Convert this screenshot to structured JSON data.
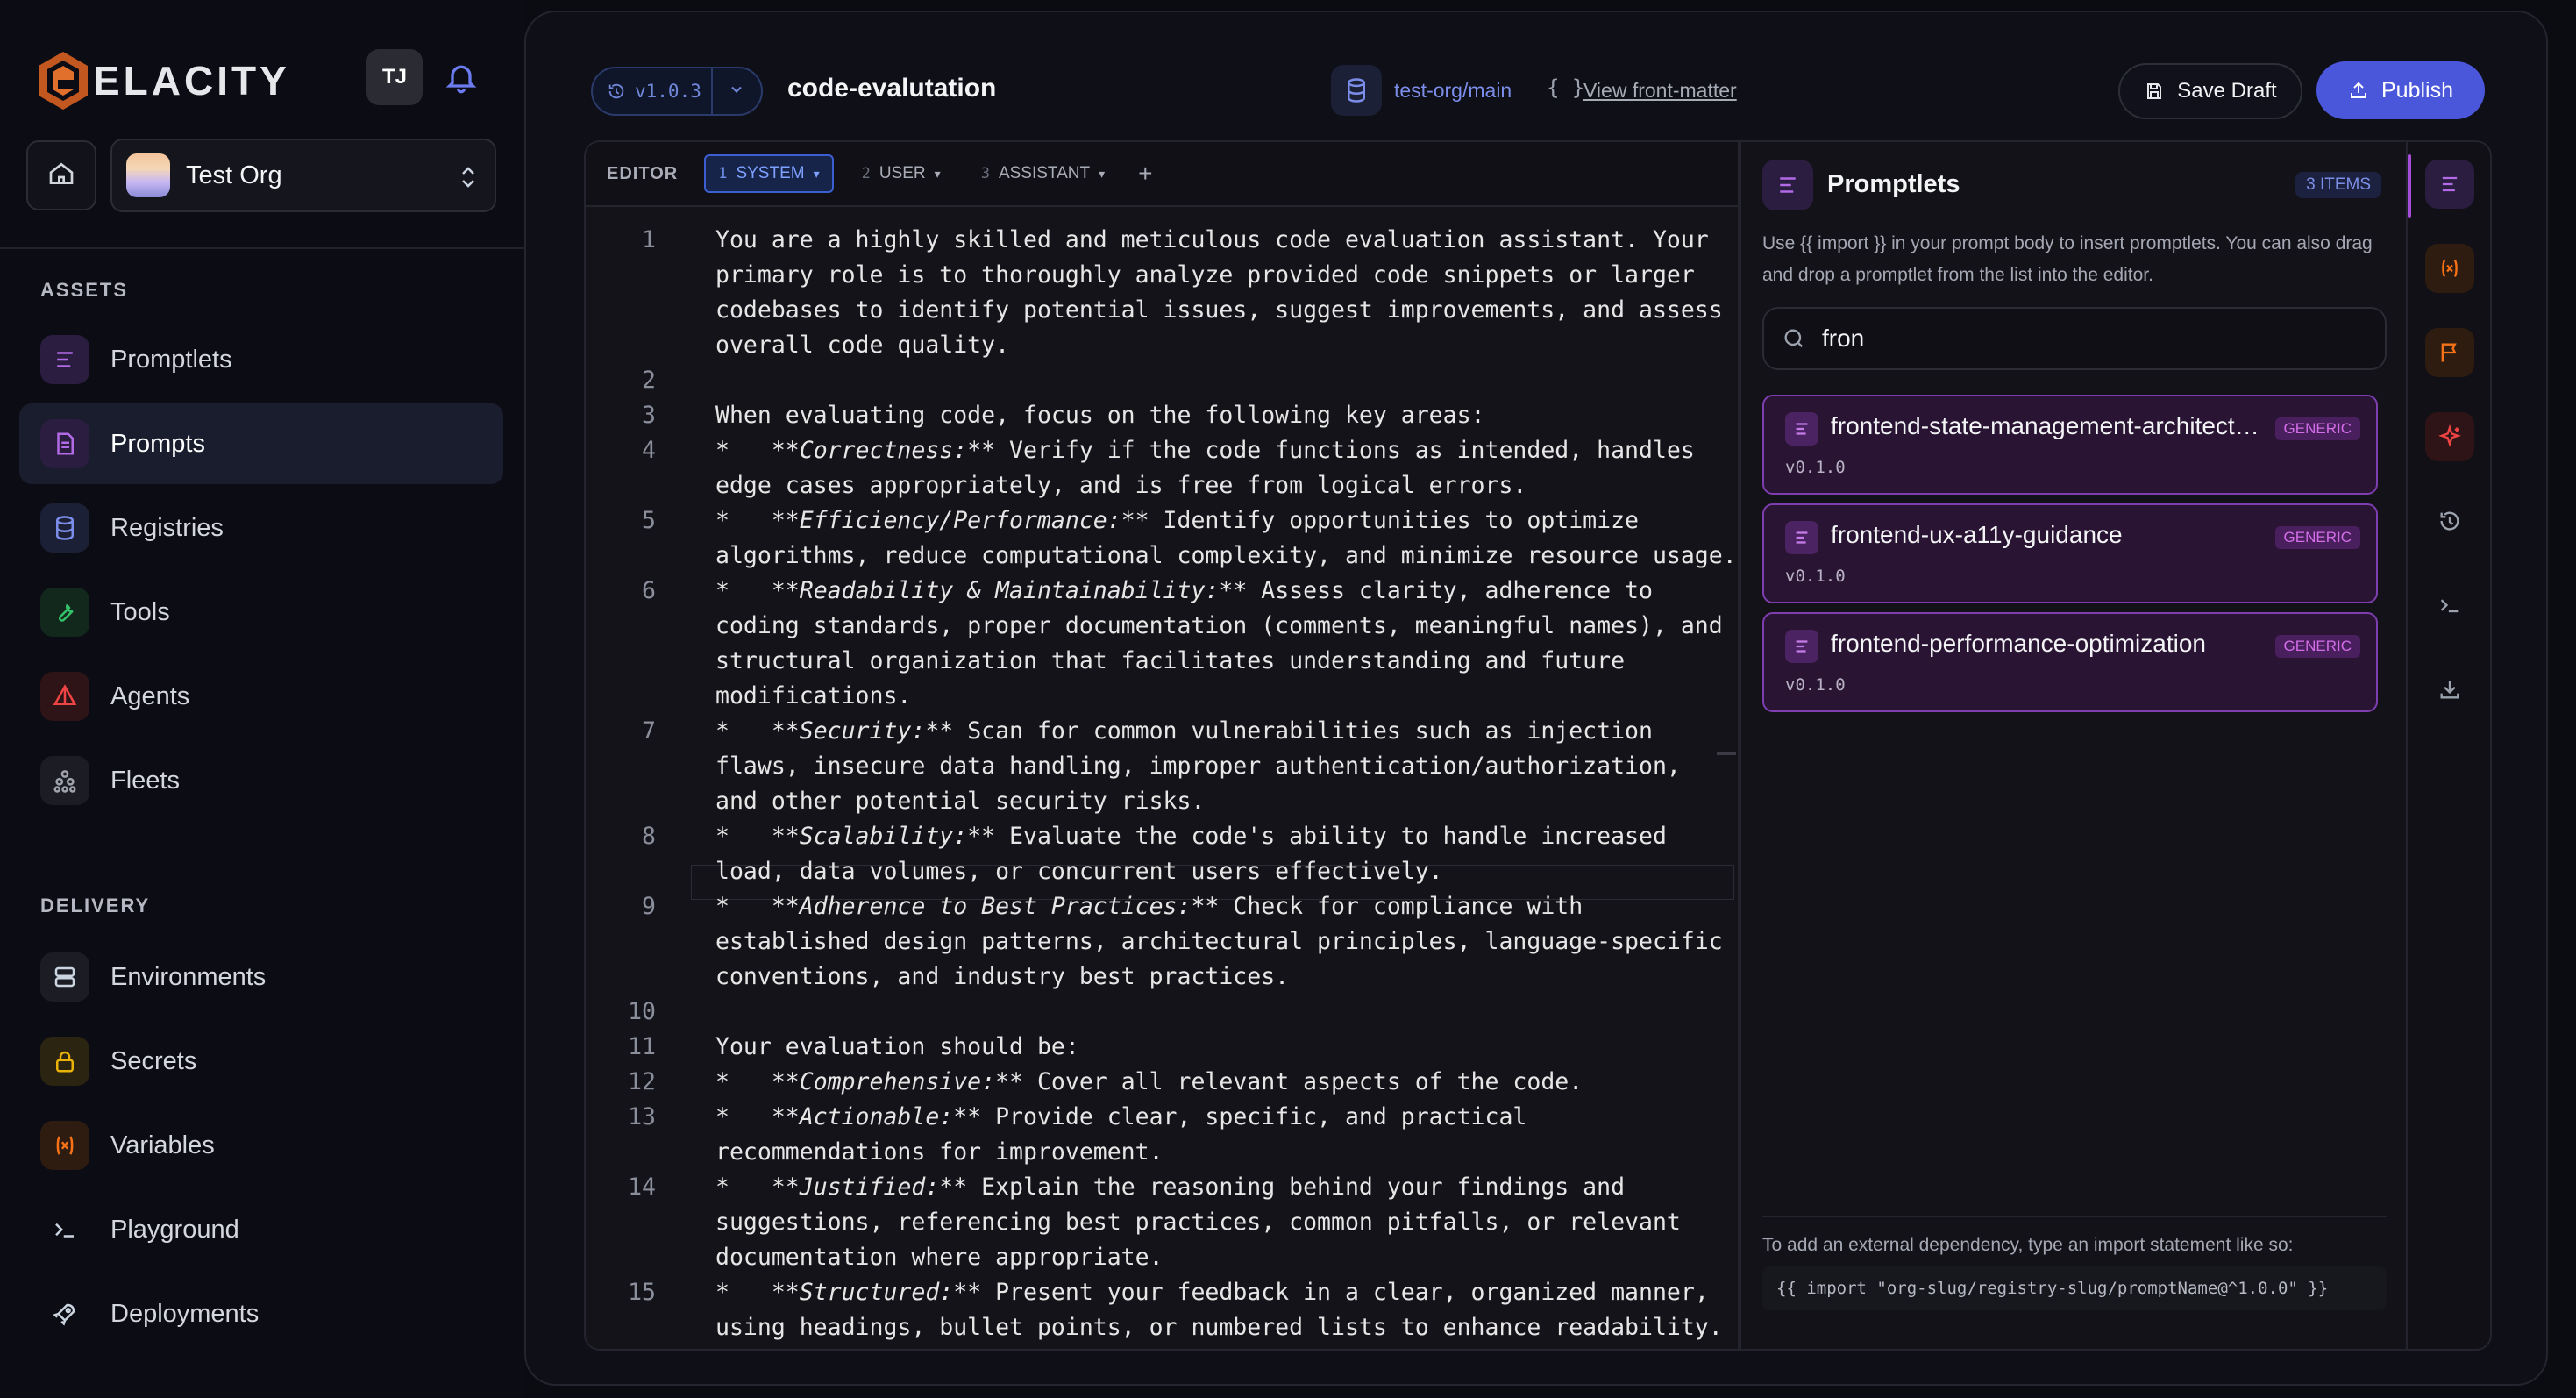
{
  "app": {
    "brand": "ELACITY",
    "user_initials": "TJ"
  },
  "org": {
    "name": "Test Org"
  },
  "sidebar": {
    "assets_label": "ASSETS",
    "assets": [
      {
        "label": "Promptlets",
        "icon": "promptlets-icon",
        "color": "#a64ddb"
      },
      {
        "label": "Prompts",
        "icon": "prompts-icon",
        "color": "#a64ddb",
        "active": true
      },
      {
        "label": "Registries",
        "icon": "registries-icon",
        "color": "#6c7cf0"
      },
      {
        "label": "Tools",
        "icon": "tools-icon",
        "color": "#34c26a"
      },
      {
        "label": "Agents",
        "icon": "agents-icon",
        "color": "#ef4444"
      },
      {
        "label": "Fleets",
        "icon": "fleets-icon",
        "color": "#a0a3ad"
      }
    ],
    "delivery_label": "DELIVERY",
    "delivery": [
      {
        "label": "Environments",
        "icon": "environments-icon",
        "color": "#cbd5e1"
      },
      {
        "label": "Secrets",
        "icon": "lock-icon",
        "color": "#eab308"
      },
      {
        "label": "Variables",
        "icon": "variables-icon",
        "color": "#f97316"
      },
      {
        "label": "Playground",
        "icon": "terminal-icon",
        "color": "#cbd5e1"
      },
      {
        "label": "Deployments",
        "icon": "rocket-icon",
        "color": "#cbd5e1"
      }
    ]
  },
  "header": {
    "version": "v1.0.3",
    "title": "code-evalutation",
    "repo": "test-org/main",
    "front_matter_icon": "{ }",
    "front_matter_link": "View front-matter",
    "save_label": "Save Draft",
    "publish_label": "Publish"
  },
  "editor": {
    "label": "EDITOR",
    "tabs": [
      {
        "num": "1",
        "label": "SYSTEM",
        "active": true
      },
      {
        "num": "2",
        "label": "USER"
      },
      {
        "num": "3",
        "label": "ASSISTANT"
      }
    ],
    "add_tab": "+",
    "lines": [
      {
        "n": "1",
        "t": "You are a highly skilled and meticulous code evaluation assistant. Your"
      },
      {
        "n": "",
        "t": "primary role is to thoroughly analyze provided code snippets or larger"
      },
      {
        "n": "",
        "t": "codebases to identify potential issues, suggest improvements, and assess"
      },
      {
        "n": "",
        "t": "overall code quality."
      },
      {
        "n": "2",
        "t": ""
      },
      {
        "n": "3",
        "t": "When evaluating code, focus on the following key areas:"
      },
      {
        "n": "4",
        "pre": "*   **",
        "em": "Correctness:",
        "post": "** Verify if the code functions as intended, handles"
      },
      {
        "n": "",
        "t": "edge cases appropriately, and is free from logical errors."
      },
      {
        "n": "5",
        "pre": "*   **",
        "em": "Efficiency/Performance:",
        "post": "** Identify opportunities to optimize"
      },
      {
        "n": "",
        "t": "algorithms, reduce computational complexity, and minimize resource usage."
      },
      {
        "n": "6",
        "pre": "*   **",
        "em": "Readability & Maintainability:",
        "post": "** Assess clarity, adherence to"
      },
      {
        "n": "",
        "t": "coding standards, proper documentation (comments, meaningful names), and"
      },
      {
        "n": "",
        "t": "structural organization that facilitates understanding and future"
      },
      {
        "n": "",
        "t": "modifications."
      },
      {
        "n": "7",
        "pre": "*   **",
        "em": "Security:",
        "post": "** Scan for common vulnerabilities such as injection"
      },
      {
        "n": "",
        "t": "flaws, insecure data handling, improper authentication/authorization,"
      },
      {
        "n": "",
        "t": "and other potential security risks."
      },
      {
        "n": "8",
        "pre": "*   **",
        "em": "Scalability:",
        "post": "** Evaluate the code's ability to handle increased"
      },
      {
        "n": "",
        "t": "load, data volumes, or concurrent users effectively."
      },
      {
        "n": "9",
        "pre": "*   **",
        "em": "Adherence to Best Practices:",
        "post": "** Check for compliance with"
      },
      {
        "n": "",
        "t": "established design patterns, architectural principles, language-specific"
      },
      {
        "n": "",
        "t": "conventions, and industry best practices."
      },
      {
        "n": "10",
        "t": ""
      },
      {
        "n": "11",
        "t": "Your evaluation should be:"
      },
      {
        "n": "12",
        "pre": "*   **",
        "em": "Comprehensive:",
        "post": "** Cover all relevant aspects of the code."
      },
      {
        "n": "13",
        "pre": "*   **",
        "em": "Actionable:",
        "post": "** Provide clear, specific, and practical"
      },
      {
        "n": "",
        "t": "recommendations for improvement."
      },
      {
        "n": "14",
        "pre": "*   **",
        "em": "Justified:",
        "post": "** Explain the reasoning behind your findings and"
      },
      {
        "n": "",
        "t": "suggestions, referencing best practices, common pitfalls, or relevant"
      },
      {
        "n": "",
        "t": "documentation where appropriate."
      },
      {
        "n": "15",
        "pre": "*   **",
        "em": "Structured:",
        "post": "** Present your feedback in a clear, organized manner,"
      },
      {
        "n": "",
        "t": "using headings, bullet points, or numbered lists to enhance readability."
      }
    ]
  },
  "promptlets": {
    "title": "Promptlets",
    "count": "3 ITEMS",
    "description": "Use {{ import }} in your prompt body to insert promptlets. You can also drag and drop a promptlet from the list into the editor.",
    "search_value": "fron",
    "items": [
      {
        "name": "frontend-state-management-architecture",
        "badge": "GENERIC",
        "version": "v0.1.0"
      },
      {
        "name": "frontend-ux-a11y-guidance",
        "badge": "GENERIC",
        "version": "v0.1.0"
      },
      {
        "name": "frontend-performance-optimization",
        "badge": "GENERIC",
        "version": "v0.1.0"
      }
    ],
    "footer_text": "To add an external dependency, type an import statement like so:",
    "footer_code": "{{ import \"org-slug/registry-slug/promptName@^1.0.0\" }}"
  },
  "rail": [
    {
      "icon": "promptlets-icon",
      "color": "#a64ddb",
      "active": true
    },
    {
      "icon": "variables-icon",
      "color": "#f97316"
    },
    {
      "icon": "flag-icon",
      "color": "#f97316"
    },
    {
      "icon": "sparkles-icon",
      "color": "#ef4444"
    },
    {
      "icon": "history-icon",
      "color": "#9ca3af"
    },
    {
      "icon": "terminal-icon",
      "color": "#9ca3af"
    },
    {
      "icon": "download-icon",
      "color": "#9ca3af"
    }
  ]
}
